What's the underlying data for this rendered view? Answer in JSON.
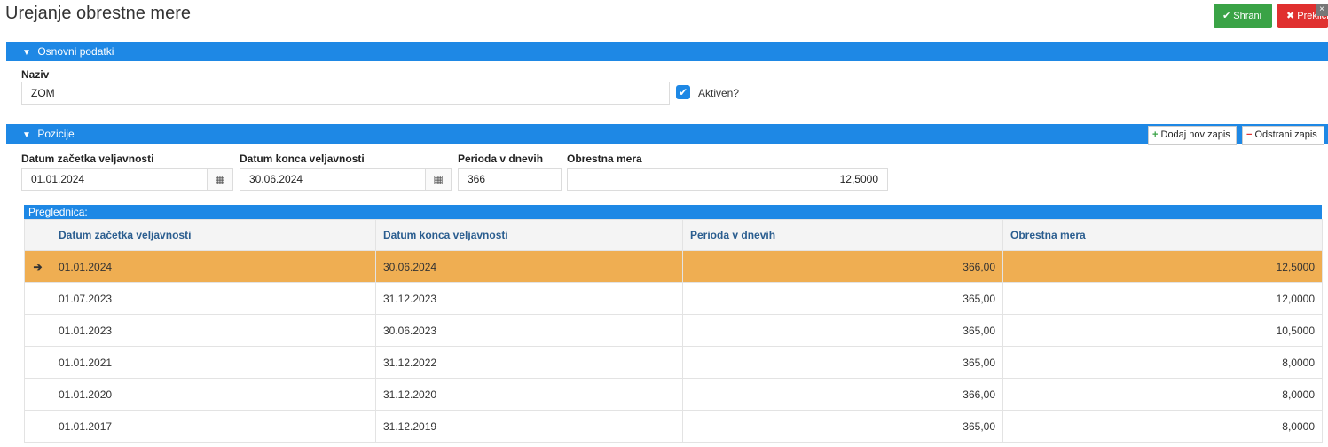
{
  "header": {
    "title": "Urejanje obrestne mere",
    "save_label": "Shrani",
    "cancel_label": "Prekliči",
    "close_glyph": "×"
  },
  "basic": {
    "section_label": "Osnovni podatki",
    "name_label": "Naziv",
    "name_value": "ZOM",
    "active_label": "Aktiven?",
    "active_checked": true
  },
  "positions": {
    "section_label": "Pozicije",
    "add_label": "Dodaj nov zapis",
    "remove_label": "Odstrani zapis",
    "fields": {
      "start_label": "Datum začetka veljavnosti",
      "start_value": "01.01.2024",
      "end_label": "Datum konca veljavnosti",
      "end_value": "30.06.2024",
      "period_label": "Perioda v dnevih",
      "period_value": "366",
      "rate_label": "Obrestna mera",
      "rate_value": "12,5000"
    }
  },
  "grid": {
    "title": "Preglednica:",
    "columns": [
      "Datum začetka veljavnosti",
      "Datum konca veljavnosti",
      "Perioda v dnevih",
      "Obrestna mera"
    ],
    "rows": [
      {
        "start": "01.01.2024",
        "end": "30.06.2024",
        "period": "366,00",
        "rate": "12,5000",
        "selected": true
      },
      {
        "start": "01.07.2023",
        "end": "31.12.2023",
        "period": "365,00",
        "rate": "12,0000"
      },
      {
        "start": "01.01.2023",
        "end": "30.06.2023",
        "period": "365,00",
        "rate": "10,5000"
      },
      {
        "start": "01.01.2021",
        "end": "31.12.2022",
        "period": "365,00",
        "rate": "8,0000"
      },
      {
        "start": "01.01.2020",
        "end": "31.12.2020",
        "period": "366,00",
        "rate": "8,0000"
      },
      {
        "start": "01.01.2017",
        "end": "31.12.2019",
        "period": "365,00",
        "rate": "8,0000"
      }
    ]
  },
  "colors": {
    "accent": "#1e88e5",
    "save": "#3aa346",
    "cancel": "#e0302f",
    "selected_row": "#efae52"
  }
}
